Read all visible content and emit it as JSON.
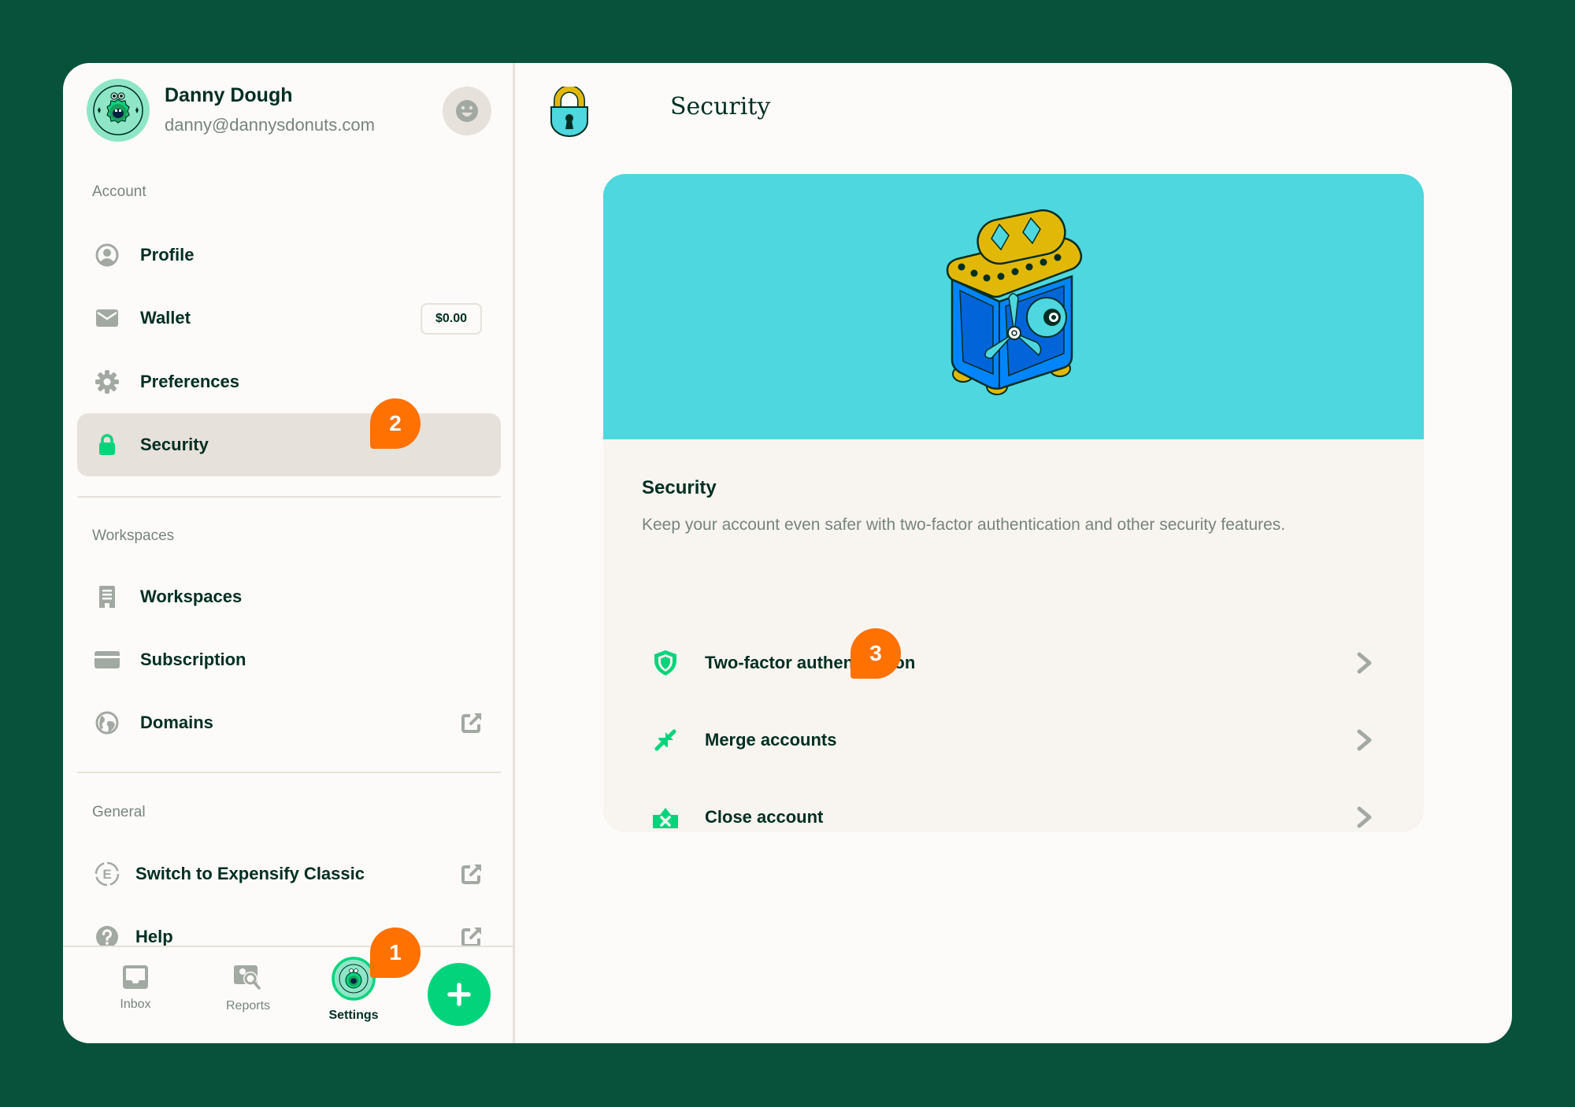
{
  "user": {
    "name": "Danny Dough",
    "email": "danny@dannysdonuts.com"
  },
  "sidebar": {
    "sections": [
      {
        "label": "Account",
        "items": [
          {
            "label": "Profile",
            "icon": "user-circle-icon"
          },
          {
            "label": "Wallet",
            "icon": "wallet-icon",
            "badge": "$0.00"
          },
          {
            "label": "Preferences",
            "icon": "gear-icon"
          },
          {
            "label": "Security",
            "icon": "lock-icon",
            "active": true
          }
        ]
      },
      {
        "label": "Workspaces",
        "items": [
          {
            "label": "Workspaces",
            "icon": "building-icon"
          },
          {
            "label": "Subscription",
            "icon": "credit-card-icon"
          },
          {
            "label": "Domains",
            "icon": "globe-icon",
            "external": true
          }
        ]
      },
      {
        "label": "General",
        "items": [
          {
            "label": "Switch to Expensify Classic",
            "icon": "expensify-classic-icon",
            "external": true
          },
          {
            "label": "Help",
            "icon": "question-icon",
            "external": true
          }
        ]
      }
    ]
  },
  "bottom_tabs": [
    {
      "label": "Inbox",
      "icon": "inbox-icon"
    },
    {
      "label": "Reports",
      "icon": "reports-search-icon"
    },
    {
      "label": "Settings",
      "icon": "avatar-icon",
      "active": true
    }
  ],
  "fab_label": "+",
  "main": {
    "title": "Security",
    "card": {
      "title": "Security",
      "description": "Keep your account even safer with two-factor authentication and other security features.",
      "rows": [
        {
          "label": "Two-factor authentication",
          "icon": "shield-icon"
        },
        {
          "label": "Merge accounts",
          "icon": "merge-arrows-icon"
        },
        {
          "label": "Close account",
          "icon": "close-account-icon"
        }
      ]
    }
  },
  "annotations": [
    "1",
    "2",
    "3"
  ],
  "colors": {
    "background": "#08513B",
    "accent_green": "#03D47C",
    "annotation_orange": "#FF7101",
    "hero_teal": "#4ED7DE",
    "text_dark": "#002E22",
    "text_muted": "#76847E"
  }
}
